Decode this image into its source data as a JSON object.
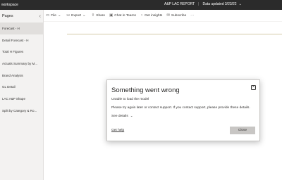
{
  "topbar": {
    "workspace": "workspace",
    "report_name": "A&P LAC REPORT",
    "separator": "|",
    "data_updated": "Data updated 3/23/22",
    "chevron_icon": "chevron-down-icon"
  },
  "sidebar": {
    "header": "Pages",
    "collapse_icon": "collapse-icon",
    "items": [
      {
        "label": "Forecast - H",
        "active": true
      },
      {
        "label": "Detail Forecast - H",
        "active": false
      },
      {
        "label": "Total H Figures",
        "active": false
      },
      {
        "label": "Actuals Summary by M...",
        "active": false
      },
      {
        "label": "Brand Analysis",
        "active": false
      },
      {
        "label": "GL Detail",
        "active": false
      },
      {
        "label": "LAC A&P Shape",
        "active": false
      },
      {
        "label": "Split by Category & Ro...",
        "active": false
      }
    ]
  },
  "toolbar": {
    "file": "File",
    "export": "Export",
    "share": "Share",
    "chat": "Chat in Teams",
    "insights": "Get insights",
    "subscribe": "Subscribe",
    "more": "···"
  },
  "dialog": {
    "title": "Something went wrong",
    "message": "Unable to load the model",
    "instruction": "Please try again later or contact support. If you contact support, please provide these details.",
    "details_label": "See details",
    "help_link": "Get help",
    "close_button": "Close",
    "close_icon": "×"
  },
  "colors": {
    "topbar_bg": "#2b2b2b",
    "sidebar_bg": "#f3f2f1",
    "active_item_bg": "#e1dfdd",
    "close_button_bg": "#c8c6c4"
  }
}
